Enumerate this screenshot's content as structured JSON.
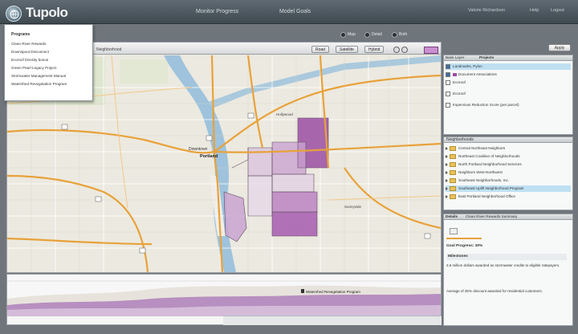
{
  "app": {
    "title": "Tupolo"
  },
  "nav": {
    "items": [
      "Monitor Progress",
      "Model Goals"
    ]
  },
  "topright": {
    "user": "Valorie Richardson",
    "help": "Help",
    "logout": "Logout"
  },
  "view_toggle": {
    "options": [
      "Map",
      "Detail",
      "Both"
    ]
  },
  "programs_menu": {
    "heading": "Programs",
    "items": [
      "Clean River Rewards",
      "Downspout Disconnect",
      "Ecoroof Density bonus",
      "Green Pearl Legacy Project",
      "Stormwater Management Manual",
      "Watershed Revegetation Program"
    ]
  },
  "map": {
    "title": "Neighborhood",
    "buttons": [
      "Road",
      "Satellite",
      "Hybrid"
    ],
    "labels": [
      "Downtown",
      "Portland",
      "Hollywood",
      "Sunnyside"
    ]
  },
  "timeline": {
    "marker": "Watershed Revegetation Program"
  },
  "right": {
    "apply_button": "Apply",
    "tab_a": "Base Layer",
    "tab_b": "Projects",
    "layers": [
      {
        "label": "Landmarks, Pylon",
        "checked": true,
        "selected": true
      },
      {
        "label": "Document Associations",
        "checked": true,
        "selected": false
      },
      {
        "label": "Ecoroof",
        "checked": false,
        "selected": false
      },
      {
        "label": "Ecoroof",
        "checked": false,
        "selected": false
      },
      {
        "label": "Impervious Reduction Score (per parcel)",
        "checked": false,
        "selected": false
      }
    ],
    "neighborhoods_header": "Neighborhoods",
    "neighborhoods": [
      {
        "label": "Central Northeast Neighbors",
        "selected": false
      },
      {
        "label": "Northeast Coalition of Neighborhoods",
        "selected": false
      },
      {
        "label": "North Portland Neighborhood Services",
        "selected": false
      },
      {
        "label": "Neighbors West-Northwest",
        "selected": false
      },
      {
        "label": "Southeast Neighborhoods, Inc.",
        "selected": false
      },
      {
        "label": "Southeast Uplift Neighborhood Program",
        "selected": true
      },
      {
        "label": "East Portland Neighborhood Office",
        "selected": false
      }
    ],
    "details_header": "Details",
    "details_tab": "Clean River Rewards Summary",
    "details_metric": "Goal Progress: 30%",
    "details_section": "Milestones",
    "details_text1": "3.6 million dollars awarded as stormwater credits to eligible ratepayers.",
    "details_text2": "Average of 35% discount awarded for residential customers."
  },
  "colors": {
    "accent_purple": "#9b4fa2",
    "light_purple": "#d6b9dc",
    "road": "#e8a23a",
    "water": "#9fc3dc"
  }
}
